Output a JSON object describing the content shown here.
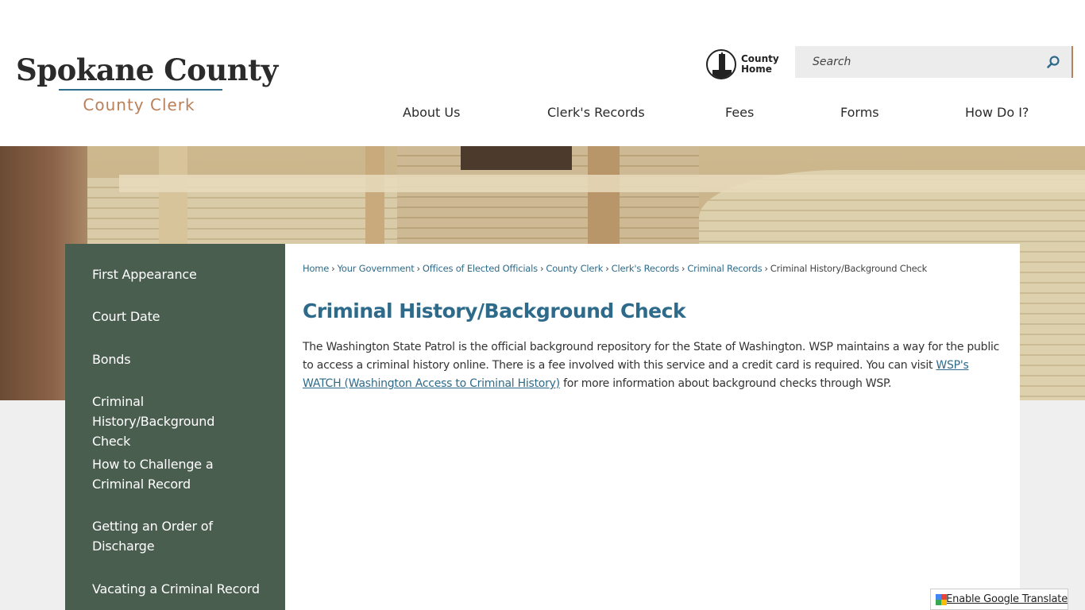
{
  "brand": {
    "title": "Spokane County",
    "subtitle": "County Clerk"
  },
  "utility": {
    "county_home_label": "County Home",
    "search_placeholder": "Search"
  },
  "nav": {
    "items": [
      {
        "label": "About Us"
      },
      {
        "label": "Clerk's Records"
      },
      {
        "label": "Fees"
      },
      {
        "label": "Forms"
      },
      {
        "label": "How Do I?"
      }
    ]
  },
  "sidebar": {
    "items": [
      {
        "label": "First Appearance"
      },
      {
        "label": "Court Date"
      },
      {
        "label": "Bonds"
      },
      {
        "label": "Criminal History/Background Check"
      },
      {
        "label": "How to Challenge a Criminal Record"
      },
      {
        "label": "Getting an Order of Discharge"
      },
      {
        "label": "Vacating a Criminal Record"
      }
    ]
  },
  "breadcrumb": {
    "links": [
      {
        "label": "Home"
      },
      {
        "label": "Your Government"
      },
      {
        "label": "Offices of Elected Officials"
      },
      {
        "label": "County Clerk"
      },
      {
        "label": "Clerk's Records"
      },
      {
        "label": "Criminal Records"
      }
    ],
    "current": "Criminal History/Background Check",
    "separator": "›"
  },
  "content": {
    "title": "Criminal History/Background Check",
    "paragraph_before_link": "The Washington State Patrol is the official background repository for the State of Washington. WSP maintains a way for the public to access a criminal history online. There is a fee involved with this service and a credit card is required. You can visit ",
    "link_text": "WSP's WATCH (Washington Access to Criminal History)",
    "paragraph_after_link": " for more information about background checks through WSP."
  },
  "translate": {
    "label": "Enable Google Translate"
  },
  "colors": {
    "accent_blue": "#2e6b8a",
    "accent_tan": "#b9805a",
    "sidebar_green": "#4a5e50"
  }
}
